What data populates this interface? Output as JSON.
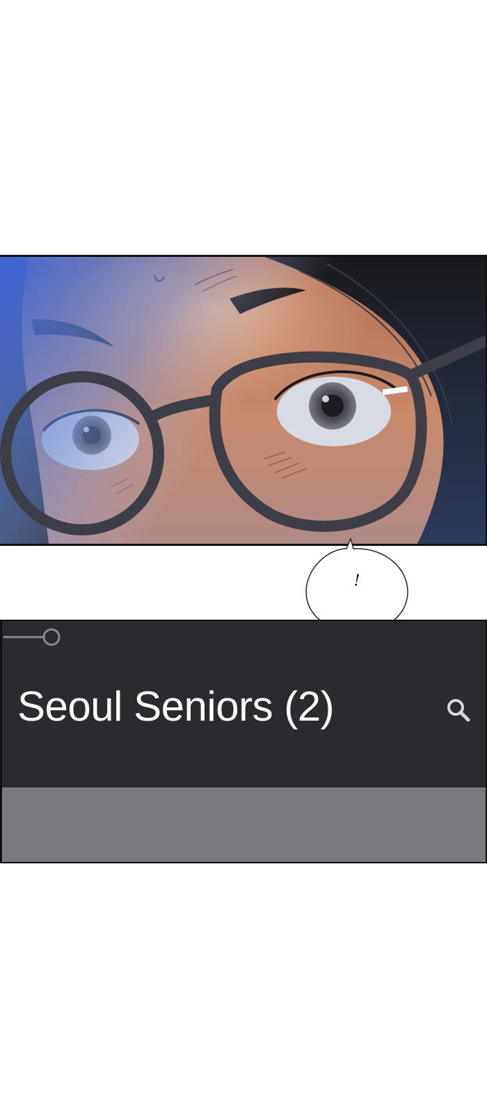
{
  "bubble": {
    "text": "!"
  },
  "chat_screen": {
    "title": "Seoul Seniors (2)",
    "icons": {
      "back": "back-slider-icon",
      "search": "search-icon"
    },
    "colors": {
      "header_bg": "#2b2a2f",
      "body_bg": "#7b7a7e",
      "title_text": "#ffffff"
    }
  }
}
